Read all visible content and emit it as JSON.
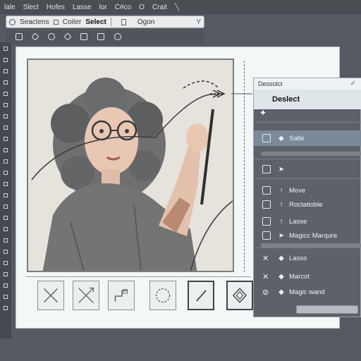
{
  "menubar": {
    "items": [
      "lale",
      "Slect",
      "Hofes",
      "Lasse",
      "lor",
      "C#co",
      "O",
      "Crait"
    ]
  },
  "options_bar": {
    "items": [
      "Seactens",
      "Coiter",
      "Select",
      "Ogon"
    ],
    "close_glyph": "Y"
  },
  "panel": {
    "header": "Dessolct",
    "title": "Deslect",
    "items": [
      {
        "label": "Salte",
        "icon": "resize-icon"
      },
      {
        "label": "",
        "icon": "transform-icon"
      },
      {
        "label": "Move",
        "icon": "move-icon"
      },
      {
        "label": "Roctatioble",
        "icon": "rotate-icon"
      },
      {
        "label": "Lasse",
        "icon": "lasso-icon"
      },
      {
        "label": "Magicc Marqure",
        "icon": "marquee-icon"
      },
      {
        "label": "Lasso",
        "icon": "lasso-tool-icon"
      },
      {
        "label": "Marcot",
        "icon": "marquee-tool-icon"
      },
      {
        "label": "Magic wand",
        "icon": "magic-wand-icon"
      }
    ]
  },
  "colors": {
    "app_bg": "#555a60",
    "canvas_bg": "#f2f7f7",
    "panel_bg": "#5c6268",
    "highlight": "#7a8a9a"
  }
}
